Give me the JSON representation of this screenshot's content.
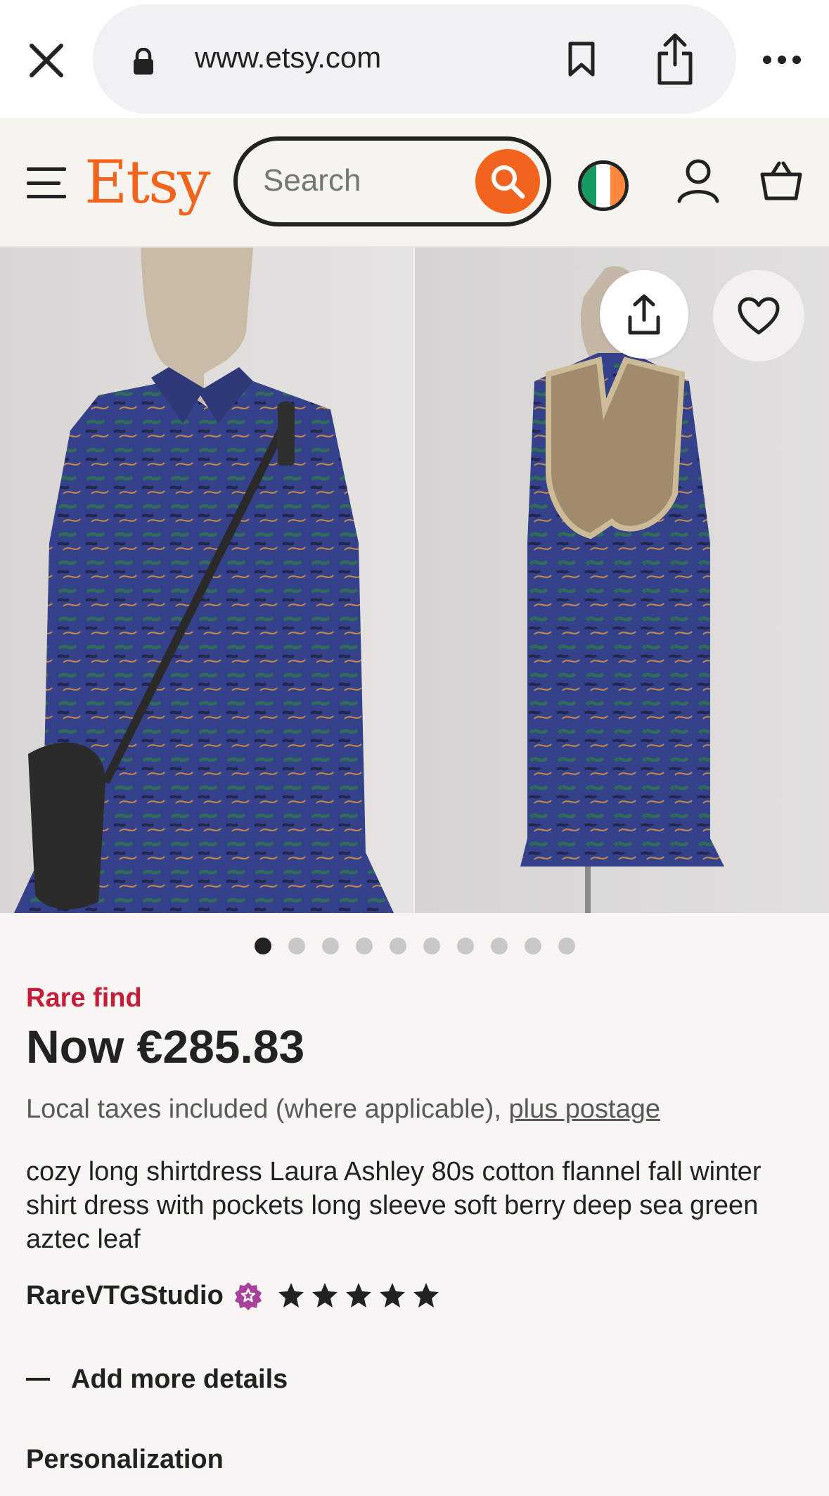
{
  "browser": {
    "url": "www.etsy.com"
  },
  "header": {
    "logo": "Etsy",
    "search_placeholder": "Search",
    "brand_color": "#f1641e"
  },
  "gallery": {
    "image_count": 10,
    "active_index": 0
  },
  "listing": {
    "badge": "Rare find",
    "price": "Now €285.83",
    "taxes_text": "Local taxes included (where applicable), ",
    "postage_link": "plus postage",
    "title": "cozy long shirtdress Laura Ashley 80s cotton flannel fall winter shirt dress with pockets long sleeve soft berry deep sea green aztec leaf",
    "shop_name": "RareVTGStudio",
    "rating_stars": 5,
    "add_details_label": "Add more details",
    "personalization_heading": "Personalization",
    "badge_color": "#c51c3a"
  },
  "icons": [
    "close-icon",
    "lock-icon",
    "bookmark-icon",
    "share-icon",
    "more-icon",
    "menu-icon",
    "search-icon",
    "ireland-flag-icon",
    "account-icon",
    "cart-icon",
    "heart-icon",
    "star-seller-icon",
    "star-icon",
    "collapse-dash-icon"
  ]
}
